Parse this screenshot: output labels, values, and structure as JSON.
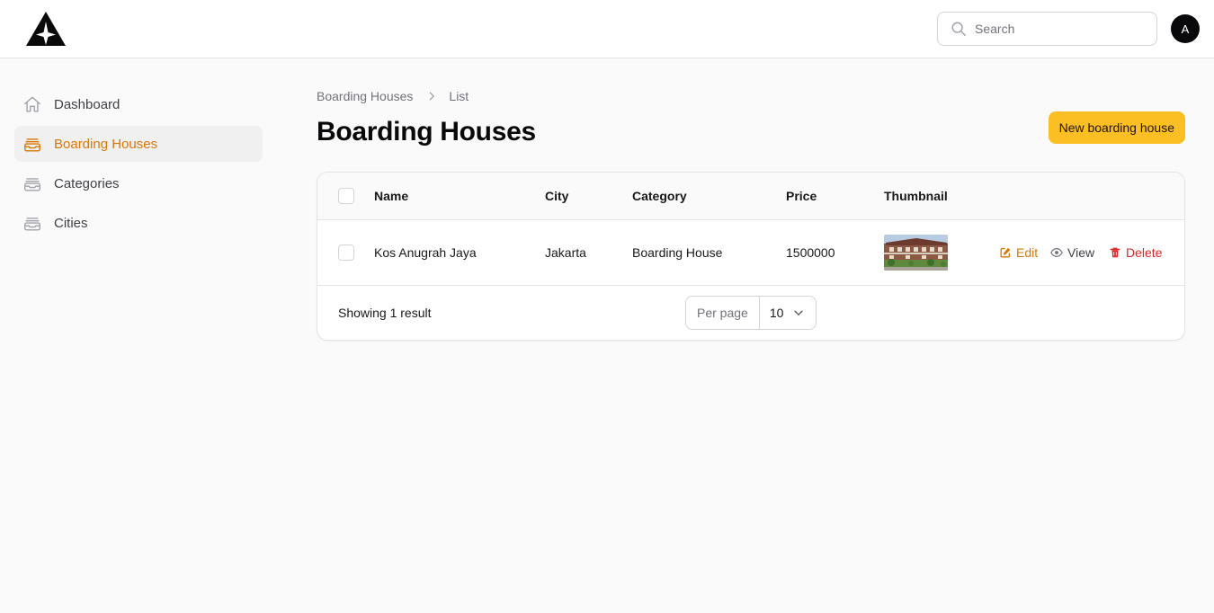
{
  "header": {
    "search_placeholder": "Search",
    "avatar_initial": "A"
  },
  "sidebar": {
    "items": [
      {
        "label": "Dashboard",
        "icon": "home-icon",
        "active": false
      },
      {
        "label": "Boarding Houses",
        "icon": "inbox-stack-icon",
        "active": true
      },
      {
        "label": "Categories",
        "icon": "inbox-stack-icon",
        "active": false
      },
      {
        "label": "Cities",
        "icon": "inbox-stack-icon",
        "active": false
      }
    ]
  },
  "breadcrumb": {
    "parent": "Boarding Houses",
    "current": "List"
  },
  "page": {
    "title": "Boarding Houses",
    "new_button_label": "New boarding house"
  },
  "table": {
    "columns": [
      "Name",
      "City",
      "Category",
      "Price",
      "Thumbnail"
    ],
    "rows": [
      {
        "name": "Kos Anugrah Jaya",
        "city": "Jakarta",
        "category": "Boarding House",
        "price": "1500000",
        "thumbnail": "building-photo"
      }
    ],
    "actions": {
      "edit": "Edit",
      "view": "View",
      "delete": "Delete"
    },
    "footer": {
      "summary": "Showing 1 result",
      "per_page_label": "Per page",
      "per_page_value": "10"
    }
  },
  "colors": {
    "accent": "#d97706",
    "primary_button": "#fbbf24",
    "danger": "#dc2626"
  }
}
